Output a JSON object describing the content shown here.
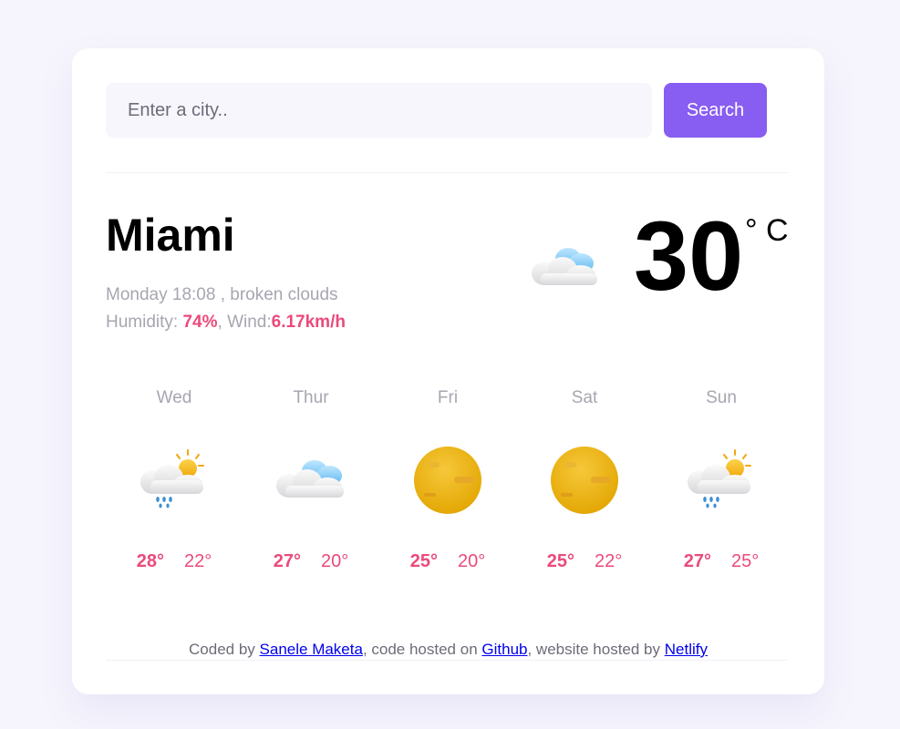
{
  "search": {
    "placeholder": "Enter a city..",
    "button_label": "Search"
  },
  "current": {
    "city": "Miami",
    "date_time": "Monday 18:08",
    "description": "broken clouds",
    "humidity_label": "Humidity:",
    "humidity_value": "74%",
    "wind_label": "Wind:",
    "wind_value": "6.17km/h",
    "temperature": "30",
    "unit": "° C",
    "icon": "broken-clouds-icon"
  },
  "forecast": [
    {
      "day": "Wed",
      "max": "28°",
      "min": "22°",
      "icon": "rain-sun-icon"
    },
    {
      "day": "Thur",
      "max": "27°",
      "min": "20°",
      "icon": "broken-clouds-icon"
    },
    {
      "day": "Fri",
      "max": "25°",
      "min": "20°",
      "icon": "sun-icon"
    },
    {
      "day": "Sat",
      "max": "25°",
      "min": "22°",
      "icon": "sun-icon"
    },
    {
      "day": "Sun",
      "max": "27°",
      "min": "25°",
      "icon": "rain-sun-icon"
    }
  ],
  "footer": {
    "coded_by": "Coded by",
    "author": "Sanele Maketa",
    "code_hosted": ", code hosted on",
    "code_host": "Github",
    "website_hosted": ", website hosted by",
    "web_host": "Netlify"
  },
  "colors": {
    "accent": "#885df1",
    "highlight": "#eb4a7b",
    "muted": "#a7a6b0"
  }
}
